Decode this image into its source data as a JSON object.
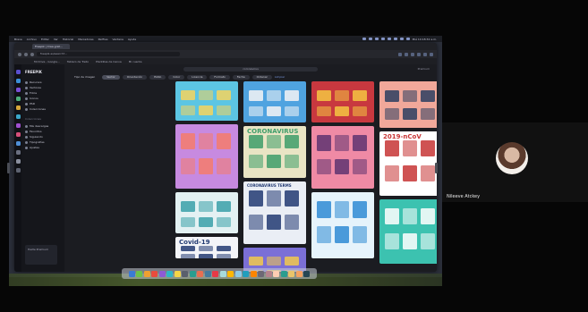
{
  "meeting": {
    "participant_name": "Nileeve Atckey"
  },
  "menubar": {
    "items": [
      "Brave",
      "Archivo",
      "Editar",
      "Ver",
      "Historial",
      "Marcadores",
      "Perfiles",
      "Ventana",
      "Ayuda"
    ],
    "clock": "Mié 10:18:32 a.m."
  },
  "browser": {
    "tab_label": "Freepik | Crea grat...",
    "url": "freepik.es/search?...",
    "bookmarks": [
      "Mi Drive - Google...",
      "Tablero de Trello",
      "Plantillas de Canva",
      "Mi cuenta"
    ]
  },
  "app": {
    "brand": "FREEPIK",
    "rail_colors": [
      "#5a4fcf",
      "#3b8fd6",
      "#7a4fd6",
      "#4cae7a",
      "#d6a73b",
      "#3ba7c9",
      "#9f4fcf",
      "#d64f7a",
      "#4f8fd6",
      "#6a6f80",
      "#8a8f9e",
      "#5d6270"
    ],
    "sidebar": {
      "items": [
        "Recursos",
        "Vectores",
        "Fotos",
        "Iconos",
        "PSD",
        "Colecciones"
      ],
      "section_title": "Colecciones",
      "section_items": [
        "Mis descargas",
        "Favoritos",
        "Siguiendo",
        "Tipografías",
        "Ajustes"
      ],
      "promo": "Hazte Premium"
    },
    "search_text": "coronavirus",
    "user_chip": "Premium",
    "filters": [
      {
        "label": "Tipo de imagen",
        "style": "first"
      },
      {
        "label": "Vector",
        "style": "active"
      },
      {
        "label": "Orientación",
        "style": ""
      },
      {
        "label": "Estilo",
        "style": ""
      },
      {
        "label": "Color",
        "style": ""
      },
      {
        "label": "Licencia",
        "style": ""
      },
      {
        "label": "Formato",
        "style": ""
      },
      {
        "label": "Fecha",
        "style": ""
      },
      {
        "label": "Ordenar",
        "style": ""
      }
    ],
    "clear_label": "Limpiar"
  },
  "cards": [
    {
      "col": 0,
      "title": "",
      "bg": "#5cc5e3",
      "accent": "#f4d35e"
    },
    {
      "col": 1,
      "title": "",
      "bg": "#4fa3e0",
      "accent": "#f5f5f5"
    },
    {
      "col": 2,
      "title": "",
      "bg": "#c8383f",
      "accent": "#f4c542"
    },
    {
      "col": 3,
      "title": "",
      "bg": "#f1a89a",
      "accent": "#2c3e60"
    },
    {
      "col": 0,
      "title": "",
      "bg": "#c78ae0",
      "accent": "#f47b6b"
    },
    {
      "col": 1,
      "title": "CORONAVIRUS",
      "bg": "#e9e4c4",
      "accent": "#3e9e6a"
    },
    {
      "col": 2,
      "title": "",
      "bg": "#ef8aa5",
      "accent": "#5e3370"
    },
    {
      "col": 3,
      "title": "2019-nCoV",
      "bg": "#ffffff",
      "accent": "#c73535"
    },
    {
      "col": 1,
      "title": "CORONAVIRUS TERMS",
      "bg": "#eaeef5",
      "accent": "#223a72"
    },
    {
      "col": 0,
      "title": "",
      "bg": "#e3f1f3",
      "accent": "#3aa0a8"
    },
    {
      "col": 2,
      "title": "",
      "bg": "#e6f3fb",
      "accent": "#2e8ad4"
    },
    {
      "col": 3,
      "title": "",
      "bg": "#3cc2b0",
      "accent": "#ffffff"
    },
    {
      "col": 1,
      "title": "",
      "bg": "#7b6fd6",
      "accent": "#f2c94c"
    },
    {
      "col": 0,
      "title": "Covid-19",
      "bg": "#f3f4f8",
      "accent": "#223a72"
    }
  ],
  "dock_colors": [
    "#3a7bd5",
    "#6cc24a",
    "#f0a030",
    "#e94c3d",
    "#8e5ad6",
    "#2fb6c8",
    "#f5d547",
    "#5a5f6c",
    "#2a9d8f",
    "#e76f51",
    "#457b9d",
    "#e63946",
    "#a8dadc",
    "#ffb703",
    "#8ecae6",
    "#219ebc",
    "#fb8500",
    "#6d6875",
    "#b5838d",
    "#ffcdb2",
    "#2a9d8f",
    "#e9c46a",
    "#f4a261",
    "#264653"
  ]
}
